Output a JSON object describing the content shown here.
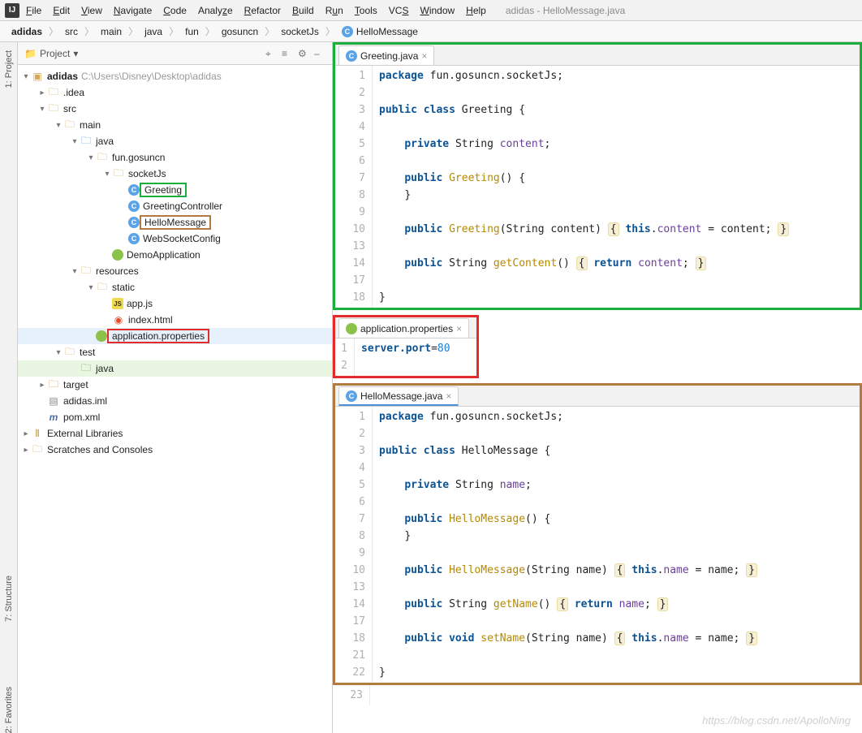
{
  "window_title": "adidas - HelloMessage.java",
  "menus": [
    "File",
    "Edit",
    "View",
    "Navigate",
    "Code",
    "Analyze",
    "Refactor",
    "Build",
    "Run",
    "Tools",
    "VCS",
    "Window",
    "Help"
  ],
  "breadcrumbs": [
    "adidas",
    "src",
    "main",
    "java",
    "fun",
    "gosuncn",
    "socketJs",
    "HelloMessage"
  ],
  "panel": {
    "title": "Project",
    "hicons": {
      "target": "⌖",
      "collapse": "≡",
      "gear": "⚙",
      "hide": "–"
    }
  },
  "side_rail": {
    "project": "1: Project",
    "structure": "7: Structure",
    "favorites": "2: Favorites"
  },
  "tree": {
    "root": {
      "label": "adidas",
      "path": "C:\\Users\\Disney\\Desktop\\adidas"
    },
    "idea": ".idea",
    "src": "src",
    "main": "main",
    "java": "java",
    "fun": "fun.gosuncn",
    "sockjs": "socketJs",
    "greeting": "Greeting",
    "greetingCtrl": "GreetingController",
    "hello": "HelloMessage",
    "websock": "WebSocketConfig",
    "demoApp": "DemoApplication",
    "resources": "resources",
    "static": "static",
    "appjs": "app.js",
    "indexhtml": "index.html",
    "appprops": "application.properties",
    "test": "test",
    "java2": "java",
    "target": "target",
    "adidasiml": "adidas.iml",
    "pom": "pom.xml",
    "extlibs": "External Libraries",
    "scratch": "Scratches and Consoles"
  },
  "editor1": {
    "tab": "Greeting.java",
    "lines": [
      "1",
      "2",
      "3",
      "4",
      "5",
      "6",
      "7",
      "8",
      "9",
      "10",
      "13",
      "14",
      "17",
      "18"
    ],
    "code": {
      "l1_pkg": "package",
      "l1_name": "fun.gosuncn.socketJs",
      "l3_pub": "public",
      "l3_class": "class",
      "l3_name": "Greeting",
      "l3_brace": "{",
      "l5_priv": "private",
      "l5_str": "String",
      "l5_content": "content",
      "l7_pub": "public",
      "l7_ctor": "Greeting",
      "l7_parens": "() {",
      "l8_close": "}",
      "l10_pub": "public",
      "l10_ctor": "Greeting",
      "l10_open": "(String content) ",
      "l10_brace": "{",
      "l10_this": "this",
      "l10_dot": ".",
      "l10_content": "content",
      "l10_eq": " = content; ",
      "l10_close": "}",
      "l14_pub": "public",
      "l14_str": "String",
      "l14_get": "getContent",
      "l14_open": "() ",
      "l14_brace": "{",
      "l14_ret": "return",
      "l14_content": "content",
      "l14_semi": "; ",
      "l14_close": "}",
      "l18_close": "}"
    }
  },
  "editor2": {
    "tab": "application.properties",
    "lines": [
      "1",
      "2"
    ],
    "code": {
      "key": "server.port",
      "eq": "=",
      "val": "80"
    }
  },
  "editor3": {
    "tab": "HelloMessage.java",
    "lines": [
      "1",
      "2",
      "3",
      "4",
      "5",
      "6",
      "7",
      "8",
      "9",
      "10",
      "13",
      "14",
      "17",
      "18",
      "21",
      "22"
    ],
    "extra_line": "23",
    "code": {
      "l1_pkg": "package",
      "l1_name": "fun.gosuncn.socketJs",
      "l3_pub": "public",
      "l3_class": "class",
      "l3_name": "HelloMessage",
      "l3_brace": "{",
      "l5_priv": "private",
      "l5_str": "String",
      "l5_name": "name",
      "l7_pub": "public",
      "l7_ctor": "HelloMessage",
      "l7_parens": "() {",
      "l8_close": "}",
      "l10_pub": "public",
      "l10_ctor": "HelloMessage",
      "l10_open": "(String name) ",
      "l10_brace": "{",
      "l10_this": "this",
      "l10_name": "name",
      "l10_eq": " = name; ",
      "l10_close": "}",
      "l14_pub": "public",
      "l14_str": "String",
      "l14_get": "getName",
      "l14_open": "() ",
      "l14_brace": "{",
      "l14_ret": "return",
      "l14_name": "name",
      "l14_semi": "; ",
      "l14_close": "}",
      "l18_pub": "public",
      "l18_void": "void",
      "l18_set": "setName",
      "l18_open": "(String name) ",
      "l18_brace": "{",
      "l18_this": "this",
      "l18_name": "name",
      "l18_eq": " = name; ",
      "l18_close": "}",
      "l22_close": "}"
    }
  },
  "watermark": "https://blog.csdn.net/ApolloNing"
}
